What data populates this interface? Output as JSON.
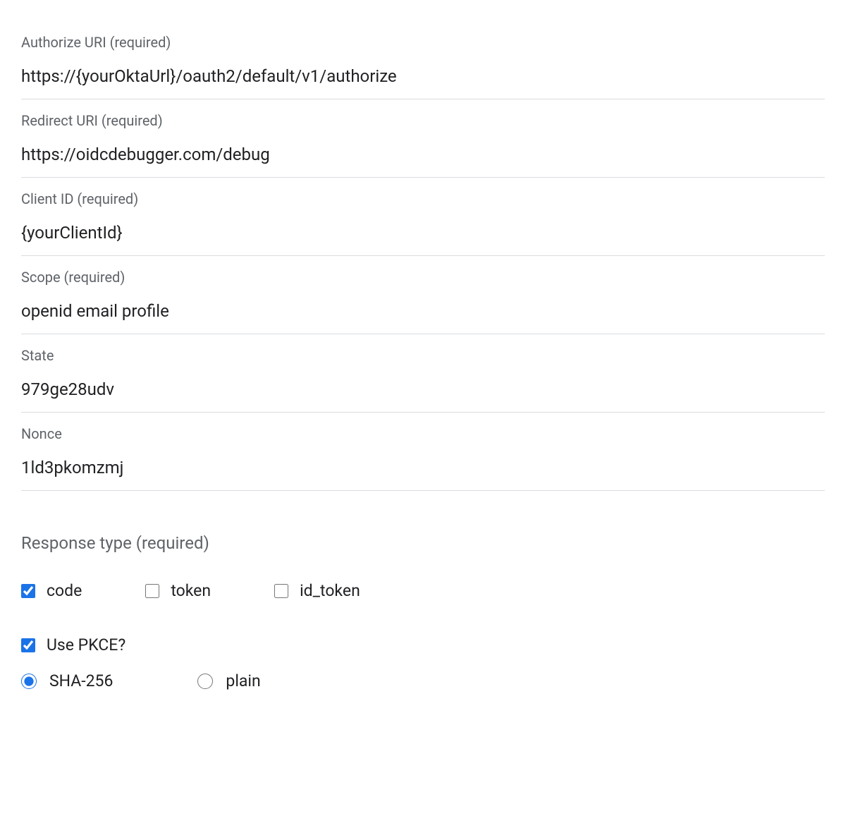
{
  "fields": {
    "authorize_uri": {
      "label": "Authorize URI (required)",
      "value": "https://{yourOktaUrl}/oauth2/default/v1/authorize"
    },
    "redirect_uri": {
      "label": "Redirect URI (required)",
      "value": "https://oidcdebugger.com/debug"
    },
    "client_id": {
      "label": "Client ID (required)",
      "value": "{yourClientId}"
    },
    "scope": {
      "label": "Scope (required)",
      "value": "openid email profile"
    },
    "state": {
      "label": "State",
      "value": "979ge28udv"
    },
    "nonce": {
      "label": "Nonce",
      "value": "1ld3pkomzmj"
    }
  },
  "response_type": {
    "heading": "Response type (required)",
    "options": {
      "code": {
        "label": "code",
        "checked": true
      },
      "token": {
        "label": "token",
        "checked": false
      },
      "id_token": {
        "label": "id_token",
        "checked": false
      }
    }
  },
  "pkce": {
    "use_label": "Use PKCE?",
    "use_checked": true,
    "methods": {
      "sha256": {
        "label": "SHA-256",
        "checked": true
      },
      "plain": {
        "label": "plain",
        "checked": false
      }
    }
  }
}
